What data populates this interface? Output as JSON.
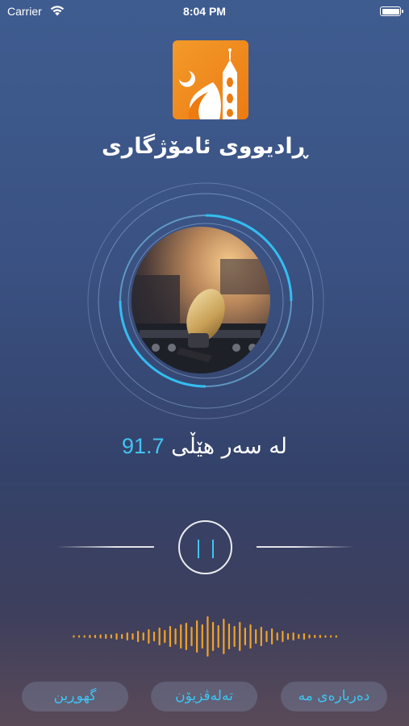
{
  "status_bar": {
    "carrier": "Carrier",
    "time": "8:04 PM"
  },
  "app": {
    "title": "ڕادیووی ئامۆژگاری"
  },
  "player": {
    "frequency_label": "لە سەر هێڵی",
    "frequency_value": "91.7",
    "accent_color": "#41c4f2",
    "waveform_color": "#f0a32a",
    "state": "playing"
  },
  "buttons": {
    "share_label": "گهوڕین",
    "contact_label": "تەلەڤزیۆن",
    "about_label": "دەربارەی مە"
  },
  "icons": {
    "logo": "mosque-logo-icon",
    "artwork": "microphone-artwork",
    "pause": "pause-icon",
    "wifi": "wifi-icon",
    "battery": "battery-icon"
  }
}
